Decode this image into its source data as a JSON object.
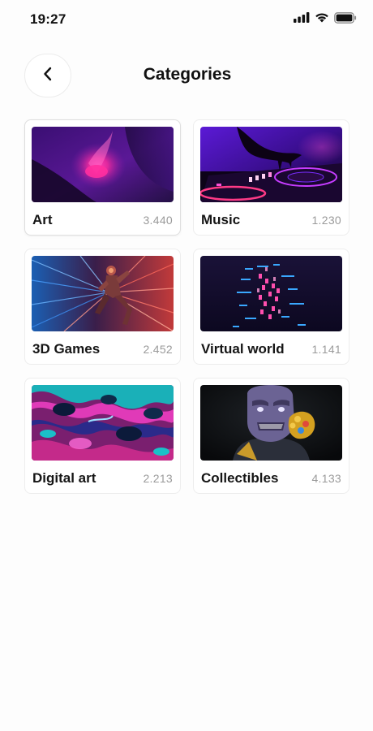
{
  "status_bar": {
    "time": "19:27",
    "icons": [
      "signal-icon",
      "wifi-icon",
      "battery-icon"
    ]
  },
  "header": {
    "back_icon": "chevron-left-icon",
    "title": "Categories"
  },
  "categories": [
    {
      "name": "Art",
      "count": "3.440",
      "image": "art-thumbnail"
    },
    {
      "name": "Music",
      "count": "1.230",
      "image": "music-thumbnail"
    },
    {
      "name": "3D Games",
      "count": "2.452",
      "image": "3d-games-thumbnail"
    },
    {
      "name": "Virtual world",
      "count": "1.141",
      "image": "virtual-world-thumbnail"
    },
    {
      "name": "Digital art",
      "count": "2.213",
      "image": "digital-art-thumbnail"
    },
    {
      "name": "Collectibles",
      "count": "4.133",
      "image": "collectibles-thumbnail"
    }
  ],
  "colors": {
    "background": "#fdfdfd",
    "card_border": "#ededed",
    "text": "#151515",
    "count_text": "#9a9a9a"
  }
}
